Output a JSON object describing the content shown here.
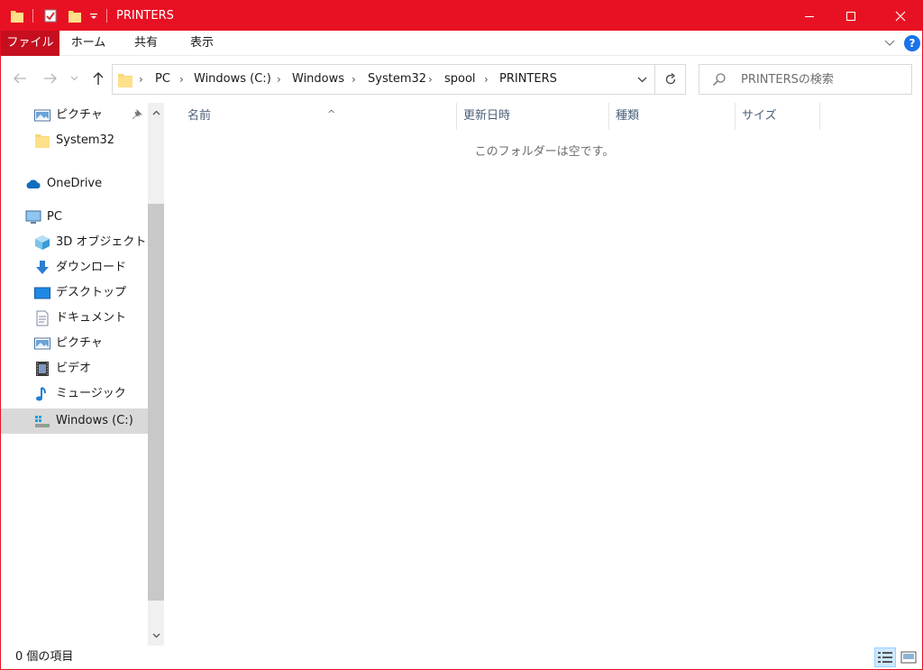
{
  "window": {
    "title": "PRINTERS",
    "accent_color": "#e81123",
    "file_tab_color": "#c50f1f"
  },
  "quick_access": {
    "icons": [
      "folder-icon",
      "properties-icon",
      "new-folder-icon",
      "customize-dropdown-icon"
    ]
  },
  "window_controls": [
    "minimize-icon",
    "maximize-icon",
    "close-icon"
  ],
  "ribbon": {
    "tabs": [
      "ファイル",
      "ホーム",
      "共有",
      "表示"
    ]
  },
  "address": {
    "segments": [
      "PC",
      "Windows (C:)",
      "Windows",
      "System32",
      "spool",
      "PRINTERS"
    ]
  },
  "search": {
    "placeholder": "PRINTERSの検索"
  },
  "navpane": {
    "items": [
      {
        "label": "ピクチャ",
        "icon": "pictures-icon",
        "pinned": true
      },
      {
        "label": "System32",
        "icon": "folder-icon"
      },
      {
        "label": "OneDrive",
        "icon": "onedrive-icon"
      },
      {
        "label": "PC",
        "icon": "pc-icon"
      },
      {
        "label": "3D オブジェクト",
        "icon": "3d-objects-icon"
      },
      {
        "label": "ダウンロード",
        "icon": "download-icon"
      },
      {
        "label": "デスクトップ",
        "icon": "desktop-icon"
      },
      {
        "label": "ドキュメント",
        "icon": "documents-icon"
      },
      {
        "label": "ピクチャ",
        "icon": "pictures-icon"
      },
      {
        "label": "ビデオ",
        "icon": "videos-icon"
      },
      {
        "label": "ミュージック",
        "icon": "music-icon"
      },
      {
        "label": "Windows (C:)",
        "icon": "drive-icon",
        "selected": true
      }
    ]
  },
  "content": {
    "columns": [
      "名前",
      "更新日時",
      "種類",
      "サイズ"
    ],
    "empty_message": "このフォルダーは空です。"
  },
  "status": {
    "item_count": "0 個の項目"
  }
}
